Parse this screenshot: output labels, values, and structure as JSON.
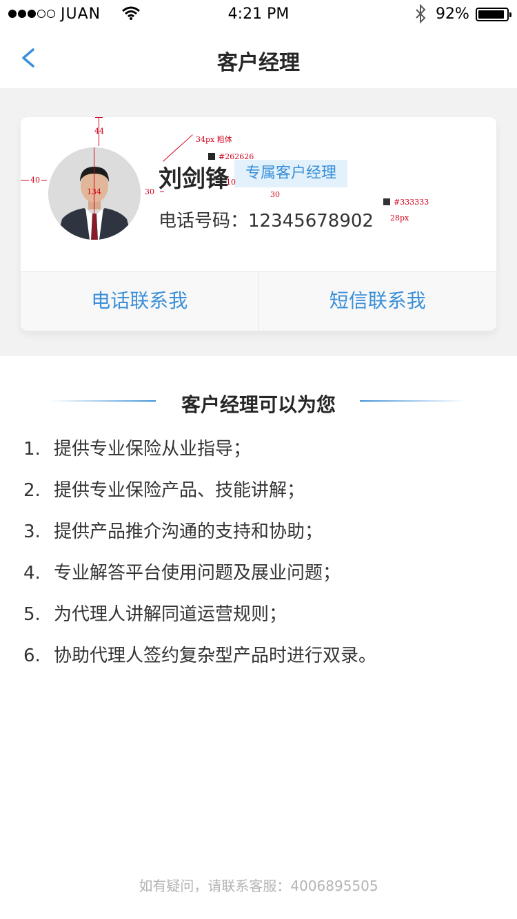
{
  "status_bar": {
    "carrier": "JUAN",
    "time": "4:21 PM",
    "battery": "92%"
  },
  "nav": {
    "title": "客户经理",
    "back_icon": "chevron-left-icon"
  },
  "card": {
    "name": "刘剑锋",
    "badge": "专属客户经理",
    "phone_label": "电话号码：",
    "phone_number": "12345678902",
    "call_button": "电话联系我",
    "sms_button": "短信联系我"
  },
  "annotations": {
    "name_spec": "34px  粗体",
    "name_color": "#262626",
    "phone_color": "#333333",
    "phone_size": "28px",
    "top_margin": "44",
    "left_margin": "40",
    "avatar_size": "134",
    "gap_avatar_text": "30",
    "gap_name_badge": "10",
    "gap_rows": "30"
  },
  "services": {
    "title": "客户经理可以为您",
    "items": [
      {
        "num": "1.",
        "text": "提供专业保险从业指导；"
      },
      {
        "num": "2.",
        "text": "提供专业保险产品、技能讲解；"
      },
      {
        "num": "3.",
        "text": "提供产品推介沟通的支持和协助；"
      },
      {
        "num": "4.",
        "text": "专业解答平台使用问题及展业问题；"
      },
      {
        "num": "5.",
        "text": "为代理人讲解同道运营规则；"
      },
      {
        "num": "6.",
        "text": "协助代理人签约复杂型产品时进行双录。"
      }
    ]
  },
  "footer": {
    "note": "如有疑问，请联系客服：4006895505"
  },
  "colors": {
    "accent": "#3a8fd8",
    "badge_bg": "#e3f1fc",
    "band_bg": "#f2f2f2",
    "annotation": "#d0021b"
  }
}
